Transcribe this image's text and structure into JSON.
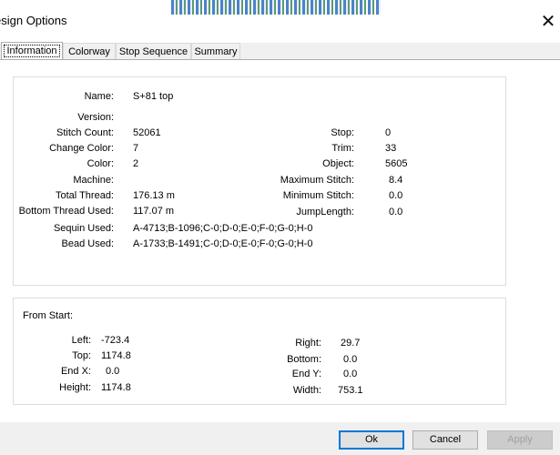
{
  "window": {
    "title": "esign Options",
    "close_glyph": "✕"
  },
  "tabs": [
    "Information",
    "Colorway",
    "Stop Sequence",
    "Summary"
  ],
  "info": {
    "name_label": "Name:",
    "name_value": "S+81 top",
    "version_label": "Version:",
    "version_value": "",
    "stitch_count_label": "Stitch Count:",
    "stitch_count_value": "52061",
    "change_color_label": "Change Color:",
    "change_color_value": "7",
    "color_label": "Color:",
    "color_value": "2",
    "machine_label": "Machine:",
    "machine_value": "",
    "total_thread_label": "Total Thread:",
    "total_thread_value": "176.13 m",
    "bottom_thread_label": "Bottom Thread Used:",
    "bottom_thread_value": "117.07 m",
    "sequin_label": "Sequin Used:",
    "sequin_value": "A-4713;B-1096;C-0;D-0;E-0;F-0;G-0;H-0",
    "bead_label": "Bead Used:",
    "bead_value": "A-1733;B-1491;C-0;D-0;E-0;F-0;G-0;H-0",
    "stop_label": "Stop:",
    "stop_value": "0",
    "trim_label": "Trim:",
    "trim_value": "33",
    "object_label": "Object:",
    "object_value": "5605",
    "max_stitch_label": "Maximum Stitch:",
    "max_stitch_value": "8.4",
    "min_stitch_label": "Minimum Stitch:",
    "min_stitch_value": "0.0",
    "jump_label": "JumpLength:",
    "jump_value": "0.0"
  },
  "from_start": {
    "heading": "From Start:",
    "left_label": "Left:",
    "left_value": "-723.4",
    "top_label": "Top:",
    "top_value": "1174.8",
    "endx_label": "End X:",
    "endx_value": "0.0",
    "height_label": "Height:",
    "height_value": "1174.8",
    "right_label": "Right:",
    "right_value": "29.7",
    "bottom_label": "Bottom:",
    "bottom_value": "0.0",
    "endy_label": "End Y:",
    "endy_value": "0.0",
    "width_label": "Width:",
    "width_value": "753.1"
  },
  "buttons": {
    "ok": "Ok",
    "cancel": "Cancel",
    "apply": "Apply"
  }
}
